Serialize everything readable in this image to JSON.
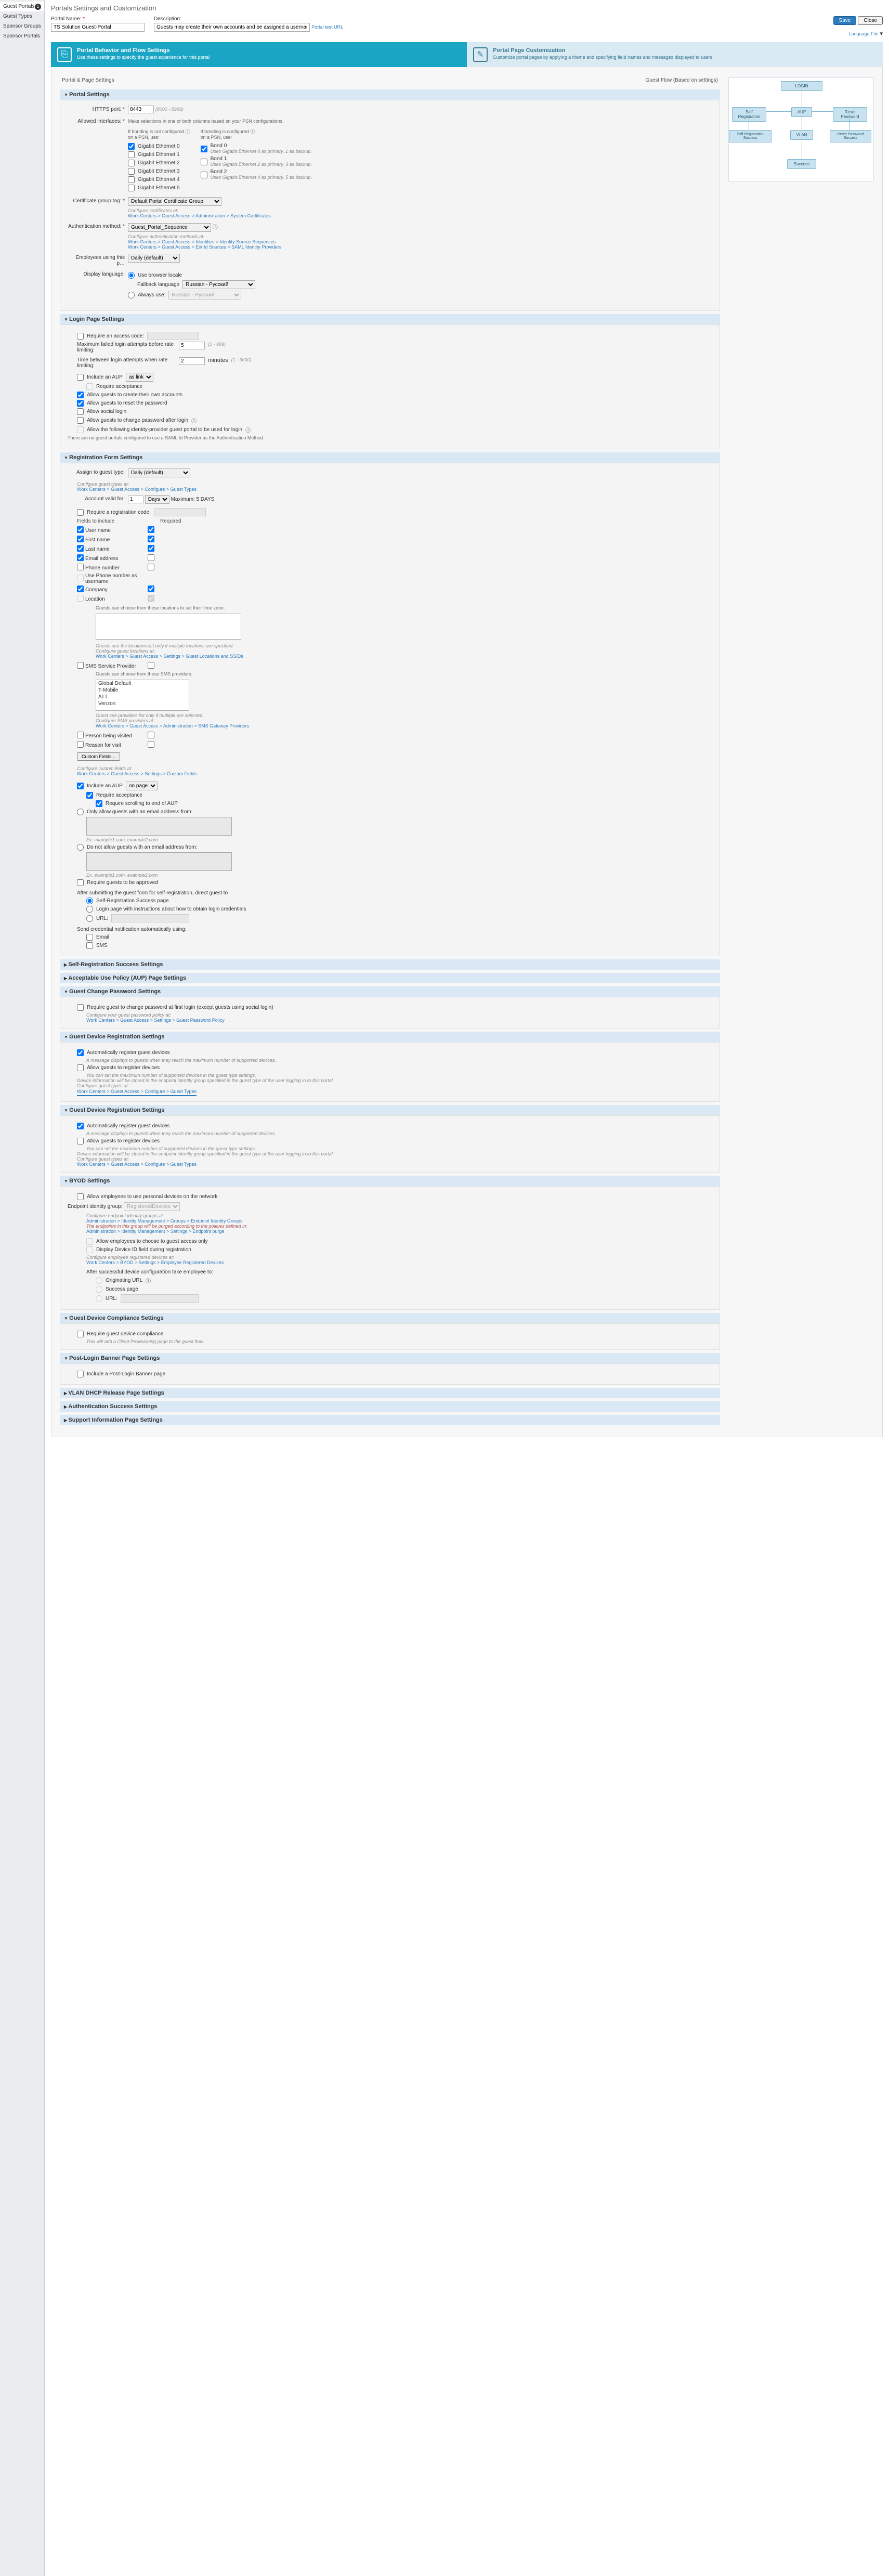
{
  "sidebar": {
    "items": [
      {
        "label": "Guest Portals",
        "active": true,
        "badge": "1"
      },
      {
        "label": "Guest Types"
      },
      {
        "label": "Sponsor Groups"
      },
      {
        "label": "Sponsor Portals"
      }
    ]
  },
  "page": {
    "title": "Portals Settings and Customization"
  },
  "header": {
    "portal_name_label": "Portal Name:",
    "portal_name": "TS Solution Guest-Portal",
    "description_label": "Description:",
    "description": "Guests may create their own accounts and be assigned a username and pa",
    "test_url": "Portal test URL",
    "save": "Save",
    "close": "Close",
    "lang_file": "Language File"
  },
  "tabs": {
    "behavior": {
      "title": "Portal Behavior and Flow Settings",
      "desc": "Use these settings to specify the guest experience for this portal"
    },
    "custom": {
      "title": "Portal Page Customization",
      "desc": "Customize portal pages by applying a theme and specifying field names and messages displayed to users."
    }
  },
  "top": {
    "left": "Portal & Page Settings",
    "right": "Guest Flow (Based on settings)"
  },
  "flow": {
    "login": "LOGIN",
    "self_reg": "Self Registration",
    "aup": "AUP",
    "reset_pw": "Reset Password",
    "self_reg_success": "Self Registration Success",
    "vlan": "VLAN",
    "reset_pw_success": "Reset Password Success",
    "success": "Success"
  },
  "portal_settings": {
    "title": "Portal Settings",
    "https_port_label": "HTTPS port: *",
    "https_port": "8443",
    "https_hint": "(8000 - 8999)",
    "allowed_label": "Allowed interfaces: *",
    "allowed_desc": "Make selections in one or both columns based on your PSN configurations.",
    "not_bonded": "If bonding is not configured",
    "on_psn": "on a PSN, use:",
    "is_bonded": "If bonding is configured",
    "on_psn2": "on a PSN, use:",
    "ifaces": [
      "Gigabit Ethernet 0",
      "Gigabit Ethernet 1",
      "Gigabit Ethernet 2",
      "Gigabit Ethernet 3",
      "Gigabit Ethernet 4",
      "Gigabit Ethernet 5"
    ],
    "bonds": [
      {
        "name": "Bond 0",
        "desc": "Uses Gigabit Ethernet 0 as primary, 1 as backup."
      },
      {
        "name": "Bond 1",
        "desc": "Uses Gigabit Ethernet 2 as primary, 3 as backup."
      },
      {
        "name": "Bond 2",
        "desc": "Uses Gigabit Ethernet 4 as primary, 5 as backup."
      }
    ],
    "cert_label": "Certificate group tag: *",
    "cert_value": "Default Portal Certificate Group",
    "cert_conf": "Configure certificates at:",
    "cert_link": "Work Centers > Guest Access > Administration > System Certificates",
    "auth_label": "Authentication method: *",
    "auth_value": "Guest_Portal_Sequence",
    "auth_conf": "Configure authentication methods at:",
    "auth_link1": "Work Centers > Guest Access > Identities > Identity Source Sequences",
    "auth_link2": "Work Centers > Guest Access > Ext Id Sources > SAML Identity Providers",
    "emp_label": "Employees using this p…",
    "emp_value": "Daily (default)",
    "disp_label": "Display language:",
    "browser_locale": "Use browser locale",
    "fallback_label": "Fallback language",
    "fallback_value": "Russian - Русский",
    "always_use": "Always use:",
    "always_value": "Russian - Русский"
  },
  "login_settings": {
    "title": "Login Page Settings",
    "access_code": "Require an access code:",
    "max_failed": "Maximum failed login attempts before rate limiting:",
    "max_failed_val": "5",
    "max_failed_hint": "(1 - 999)",
    "time_between": "Time between login attempts when rate limiting:",
    "time_val": "2",
    "time_unit": "minutes",
    "time_hint": "(1 - 3000)",
    "include_aup": "Include an AUP",
    "aup_mode": "as link",
    "require_acceptance": "Require acceptance",
    "allow_create": "Allow guests to create their own accounts",
    "allow_reset": "Allow guests to reset the password",
    "allow_social": "Allow social login",
    "allow_change_pw": "Allow guests to change password after login",
    "allow_idp": "Allow the following identity-provider guest portal to be used for login",
    "idp_note": "There are no guest portals configured to use a SAML Id Provider as the Authentication Method."
  },
  "reg_settings": {
    "title": "Registration Form Settings",
    "assign_label": "Assign to guest type:",
    "assign_value": "Daily (default)",
    "conf_types": "Configure guest types at:",
    "conf_types_link": "Work Centers > Guest Access > Configure > Guest Types",
    "valid_label": "Account valid for:",
    "valid_val": "1",
    "valid_unit": "Days",
    "valid_max": "Maximum: 5 DAYS",
    "require_reg_code": "Require a registration code:",
    "fields_label": "Fields to include",
    "required_label": "Required",
    "fields": [
      {
        "name": "User name",
        "inc": true,
        "req": true
      },
      {
        "name": "First name",
        "inc": true,
        "req": true
      },
      {
        "name": "Last name",
        "inc": true,
        "req": true
      },
      {
        "name": "Email address",
        "inc": true,
        "req": false
      },
      {
        "name": "Phone number",
        "inc": false,
        "req": false
      },
      {
        "name": "Use Phone number as username",
        "inc": false,
        "req": null
      },
      {
        "name": "Company",
        "inc": true,
        "req": true
      },
      {
        "name": "Location",
        "inc": false,
        "req": true
      }
    ],
    "loc_desc": "Guests can choose from these locations to set their time zone:",
    "loc_hint": "Guests see the locations list only if multiple locations are specified.",
    "conf_loc": "Configure guest locations at:",
    "conf_loc_link": "Work Centers > Guest Access > Settings > Guest Locations and SSIDs",
    "sms_label": "SMS Service Provider",
    "sms_desc": "Guests can choose from these SMS providers:",
    "sms_opts": [
      "Global Default",
      "T-Mobile",
      "ATT",
      "Verizon"
    ],
    "sms_hint": "Guest see providers list only if multiple are selected.",
    "conf_sms": "Configure SMS providers at:",
    "conf_sms_link": "Work Centers > Guest Access > Administration > SMS Gateway Providers",
    "person_visited": "Person being visited",
    "reason": "Reason for visit",
    "custom_fields": "Custom Fields...",
    "conf_custom": "Configure custom fields at:",
    "conf_custom_link": "Work Centers > Guest Access > Settings > Custom Fields",
    "include_aup": "Include an AUP",
    "aup_mode": "on page",
    "require_acceptance": "Require acceptance",
    "require_scroll": "Require scrolling to end of AUP",
    "only_allow": "Only allow guests with an email address from:",
    "ex1": "Ex. example1.com, example2.com",
    "do_not_allow": "Do not allow guests with an email address from:",
    "ex2": "Ex. example1.com, example2.com",
    "require_approve": "Require guests to be approved",
    "after_submit": "After submitting the guest form for self-registration, direct guest to",
    "opt_success": "Self-Registration Success page",
    "opt_login": "Login page with instructions about how to obtain login credentials",
    "opt_url": "URL:",
    "send_cred": "Send credential notification automatically using:",
    "cred_email": "Email",
    "cred_sms": "SMS"
  },
  "collapsed_panels": {
    "p1": "Self-Registration Success Settings",
    "p2": "Acceptable Use Policy (AUP) Page Settings",
    "p3": "Guest Change Password Settings"
  },
  "change_pw": {
    "require": "Require guest to change password at first login (except guests using social login)",
    "conf": "Configure your guest password policy at:",
    "link": "Work Centers > Guest Access > Settings > Guest Password Policy"
  },
  "dev_reg1": {
    "title": "Guest Device Registration Settings",
    "auto": "Automatically register guest devices",
    "msg": "A message displays to guests when they reach the maximum number of supported devices.",
    "allow": "Allow guests to register devices",
    "note1": "You can set the maximum number of supported devices in the guest type settings.",
    "note2": "Device information will be stored in the endpoint identity group specified in the guest type of the user logging in to this portal.",
    "conf": "Configure guest types at:",
    "link": "Work Centers > Guest Access > Configure > Guest Types"
  },
  "byod": {
    "title": "BYOD Settings",
    "allow_emp": "Allow employees to use personal devices on the network",
    "eig_label": "Endpoint identity group:",
    "eig_value": "RegisteredDevices",
    "conf_eig": "Configure endpoint identity groups at:",
    "eig_link": "Administration > Identity Management > Groups > Endpoint Identity Groups",
    "eig_note1": "The endpoints in this group will be purged according to the policies defined in:",
    "eig_note2": "Administration > Identity Management > Settings > Endpoint purge",
    "allow_choose": "Allow employees to choose to guest access only",
    "display_dev": "Display Device ID field during registration",
    "conf_emp": "Configure employee registered devices at:",
    "emp_link": "Work Centers > BYOD > Settings > Employee Registered Devices",
    "after_conf": "After successful device configuration take employee to:",
    "opt_orig": "Originating URL",
    "opt_succ": "Success page",
    "opt_url": "URL:"
  },
  "compliance": {
    "title": "Guest Device Compliance Settings",
    "require": "Require guest device compliance",
    "note": "This will add a Client Provisioning page to the guest flow."
  },
  "post_login": {
    "title": "Post-Login Banner Page Settings",
    "include": "Include a Post-Login Banner page"
  },
  "bottom_panels": {
    "p1": "VLAN DHCP Release Page Settings",
    "p2": "Authentication Success Settings",
    "p3": "Support Information Page Settings"
  }
}
